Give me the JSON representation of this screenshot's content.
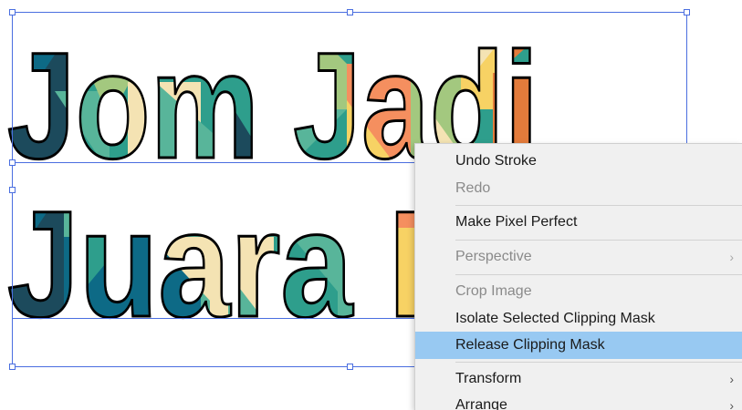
{
  "artboard": {
    "line1": "Jom Jadi",
    "line2": "Juara K",
    "palette": [
      "#1c4a5c",
      "#2e9e8c",
      "#58b59a",
      "#a3c87f",
      "#f4e3b3",
      "#f7d264",
      "#f58f5f",
      "#e37b3b",
      "#0d6a86"
    ],
    "selection_color": "#4a6ee0"
  },
  "context_menu": {
    "items": [
      {
        "label": "Undo Stroke",
        "enabled": true
      },
      {
        "label": "Redo",
        "enabled": false
      },
      {
        "label": "Make Pixel Perfect",
        "enabled": true
      },
      {
        "label": "Perspective",
        "enabled": false,
        "submenu": true
      },
      {
        "label": "Crop Image",
        "enabled": false
      },
      {
        "label": "Isolate Selected Clipping Mask",
        "enabled": true
      },
      {
        "label": "Release Clipping Mask",
        "enabled": true,
        "highlighted": true
      },
      {
        "label": "Transform",
        "enabled": true,
        "submenu": true
      },
      {
        "label": "Arrange",
        "enabled": true,
        "submenu": true
      }
    ],
    "submenu_glyph": "›",
    "highlight_color": "#98c9f2"
  }
}
